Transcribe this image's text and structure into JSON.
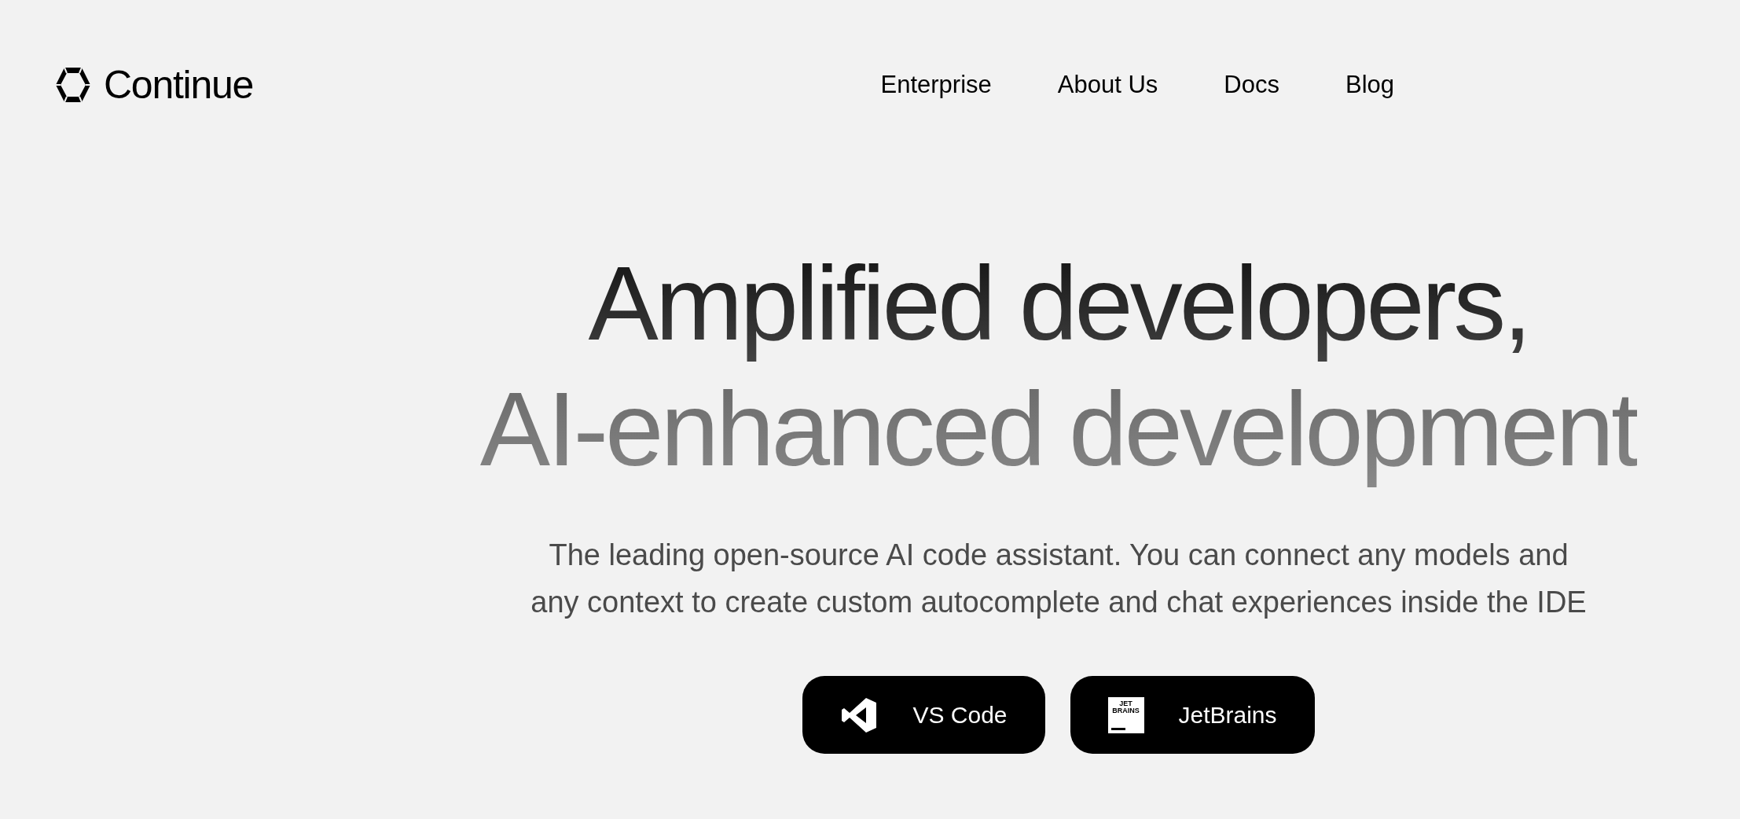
{
  "brand": {
    "name": "Continue"
  },
  "nav": [
    "Enterprise",
    "About Us",
    "Docs",
    "Blog"
  ],
  "hero": {
    "headline": [
      "Amplified developers,",
      "AI-enhanced development"
    ],
    "subtitle": [
      "The leading open-source AI code assistant. You can connect any models and",
      "any context to create custom autocomplete and chat experiences inside the IDE"
    ],
    "buttons": [
      {
        "kind": "vscode",
        "label": "VS Code"
      },
      {
        "kind": "jetbrains",
        "label": "JetBrains",
        "icon_text": [
          "JET",
          "BRAINS"
        ]
      }
    ]
  }
}
